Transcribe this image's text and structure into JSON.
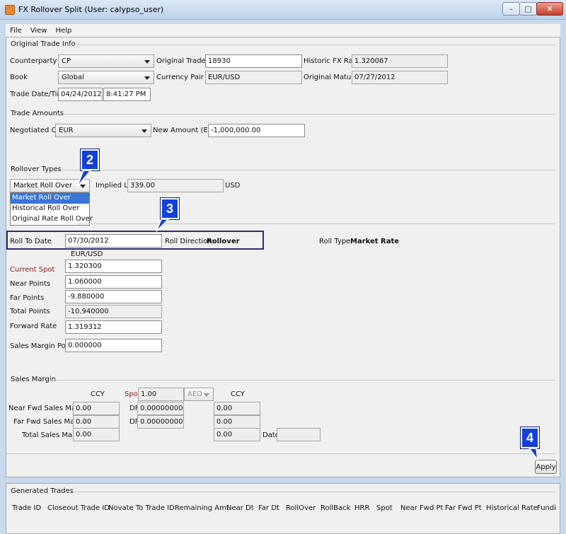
{
  "window": {
    "title": "FX Rollover Split (User: calypso_user)"
  },
  "menu": {
    "items": [
      "File",
      "View",
      "Help"
    ]
  },
  "original_trade_info": {
    "section_title": "Original Trade Info",
    "counterparty_label": "Counterparty",
    "counterparty_value": "CP",
    "book_label": "Book",
    "book_value": "Global",
    "trade_date_label": "Trade Date/Time",
    "trade_date_value": "04/24/2012",
    "trade_time_value": "8:41:27 PM",
    "original_trade_id_label": "Original Trade ID",
    "original_trade_id_value": "18930",
    "currency_pair_label": "Currency Pair",
    "currency_pair_value": "EUR/USD",
    "historic_fx_rate_label": "Historic FX Rate",
    "historic_fx_rate_value": "1.320067",
    "original_maturity_label": "Original Maturity",
    "original_maturity_value": "07/27/2012"
  },
  "trade_amounts": {
    "section_title": "Trade Amounts",
    "negotiated_ccy_label": "Negotiated Ccy",
    "negotiated_ccy_value": "EUR",
    "new_amount_label": "New Amount (EUR)",
    "new_amount_value": "-1,000,000.00"
  },
  "rollover_types": {
    "section_title": "Rollover Types",
    "selected": "Market Roll Over",
    "options": [
      "Market Roll Over",
      "Historical Roll Over",
      "Original Rate Roll Over"
    ],
    "implied_ld_label": "Implied L/D",
    "implied_ld_value": "339.00",
    "implied_ld_ccy": "USD"
  },
  "roll": {
    "roll_to_date_label": "Roll To Date",
    "roll_to_date_value": "07/30/2012",
    "roll_direction_label": "Roll Direction:",
    "roll_direction_value": "Rollover",
    "roll_type_label": "Roll Type:",
    "roll_type_value": "Market Rate",
    "pair_header": "EUR/USD",
    "current_spot_label": "Current Spot",
    "current_spot_value": "1.320300",
    "near_points_label": "Near Points",
    "near_points_value": "1.060000",
    "far_points_label": "Far Points",
    "far_points_value": "-9.880000",
    "total_points_label": "Total Points",
    "total_points_value": "-10.940000",
    "forward_rate_label": "Forward Rate",
    "forward_rate_value": "1.319312",
    "sales_margin_points_label": "Sales Margin Points",
    "sales_margin_points_value": "0.000000"
  },
  "sales_margin": {
    "section_title": "Sales Margin",
    "ccy_header_1": "CCY",
    "spot_label": "Spot",
    "spot_value": "1.00",
    "ccy_select": "AED",
    "ccy_header_2": "CCY",
    "near_fwd_label": "Near Fwd Sales Margin",
    "near_fwd_value": "0.00",
    "near_df_label": "DF",
    "near_df_value": "0.00000000",
    "near_ccy_value": "0.00",
    "far_fwd_label": "Far Fwd Sales Margin",
    "far_fwd_value": "0.00",
    "far_df_label": "DF",
    "far_df_value": "0.00000000",
    "far_ccy_value": "0.00",
    "total_label": "Total Sales Margin",
    "total_value": "0.00",
    "total_ccy_value": "0.00",
    "date_label": "Date",
    "date_value": ""
  },
  "apply_label": "Apply",
  "callouts": {
    "c2": "2",
    "c3": "3",
    "c4": "4"
  },
  "generated_trades": {
    "section_title": "Generated Trades",
    "columns": [
      "Trade ID",
      "Closeout Trade ID",
      "Novate To Trade ID",
      "Remaining Amt",
      "Near Dt",
      "Far Dt",
      "RollOver",
      "RollBack",
      "HRR",
      "Spot",
      "Near Fwd Pt",
      "Far Fwd Pt",
      "Historical Rate",
      "Fundin"
    ]
  }
}
